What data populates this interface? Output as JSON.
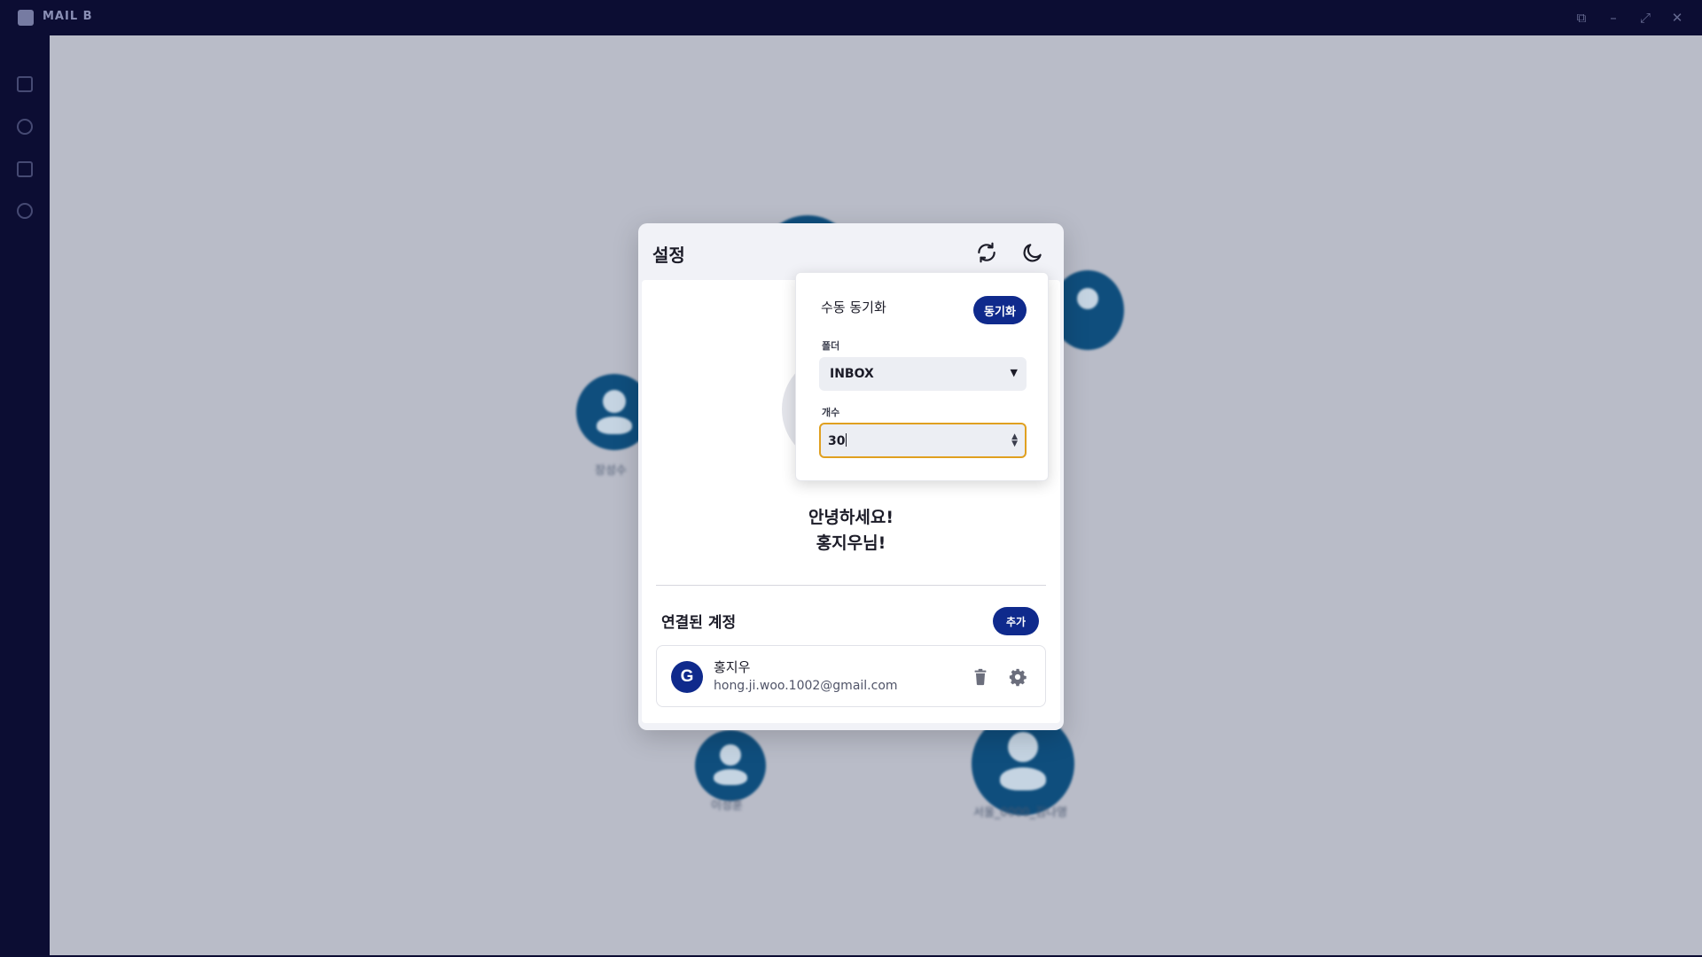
{
  "window": {
    "title": "MAIL B",
    "controls": [
      "restore-icon",
      "minimize-icon",
      "maximize-icon",
      "close-icon"
    ]
  },
  "sidebar": {
    "icons": [
      "grid-icon",
      "paperclip-icon",
      "calendar-icon",
      "settings-icon"
    ]
  },
  "background": {
    "contacts": [
      {
        "label": "장성수"
      },
      {
        "label": "이성훈"
      },
      {
        "label": "서울_0000_김나영"
      }
    ]
  },
  "dialog": {
    "title": "설정",
    "header_icons": [
      "sync-icon",
      "moon-icon"
    ],
    "greeting_line1": "안녕하세요!",
    "greeting_line2": "홍지우님!",
    "accounts_title": "연결된 계정",
    "add_label": "추가",
    "account": {
      "provider_letter": "G",
      "name": "홍지우",
      "email": "hong.ji.woo.1002@gmail.com"
    }
  },
  "sync_popover": {
    "title": "수동 동기화",
    "sync_label": "동기화",
    "folder_label": "폴더",
    "folder_value": "INBOX",
    "count_label": "개수",
    "count_value": "30"
  },
  "colors": {
    "titlebar": "#0c0d33",
    "accent": "#0f2a8c",
    "focus_ring": "#e0a020",
    "canvas": "#b9bcc8"
  }
}
